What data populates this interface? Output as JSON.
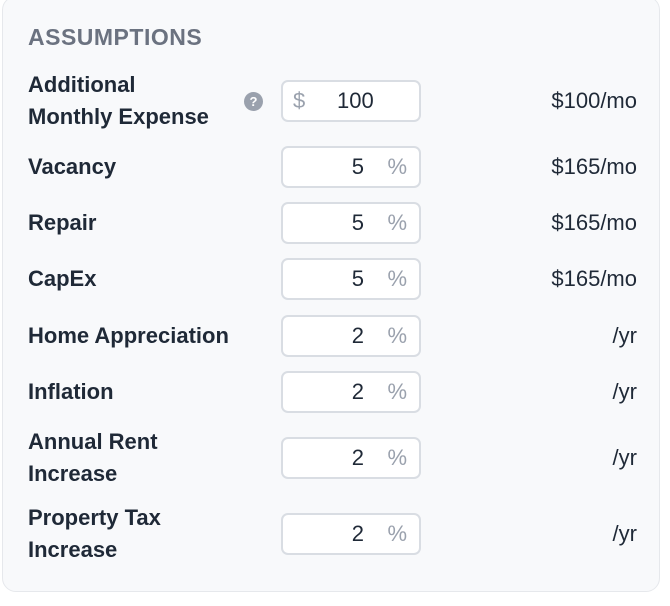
{
  "section_title": "ASSUMPTIONS",
  "help_icon": "question-circle-icon",
  "rows": [
    {
      "label_1": "Additional",
      "label_2": "Monthly Expense",
      "currency": "$",
      "value": "100",
      "result": "$100/mo"
    },
    {
      "label": "Vacancy",
      "value": "5",
      "unit": "%",
      "result": "$165/mo"
    },
    {
      "label": "Repair",
      "value": "5",
      "unit": "%",
      "result": "$165/mo"
    },
    {
      "label": "CapEx",
      "value": "5",
      "unit": "%",
      "result": "$165/mo"
    },
    {
      "label": "Home Appreciation",
      "value": "2",
      "unit": "%",
      "result": "/yr"
    },
    {
      "label": "Inflation",
      "value": "2",
      "unit": "%",
      "result": "/yr"
    },
    {
      "label_1": "Annual Rent",
      "label_2": "Increase",
      "value": "2",
      "unit": "%",
      "result": "/yr"
    },
    {
      "label_1": "Property Tax",
      "label_2": "Increase",
      "value": "2",
      "unit": "%",
      "result": "/yr"
    }
  ]
}
